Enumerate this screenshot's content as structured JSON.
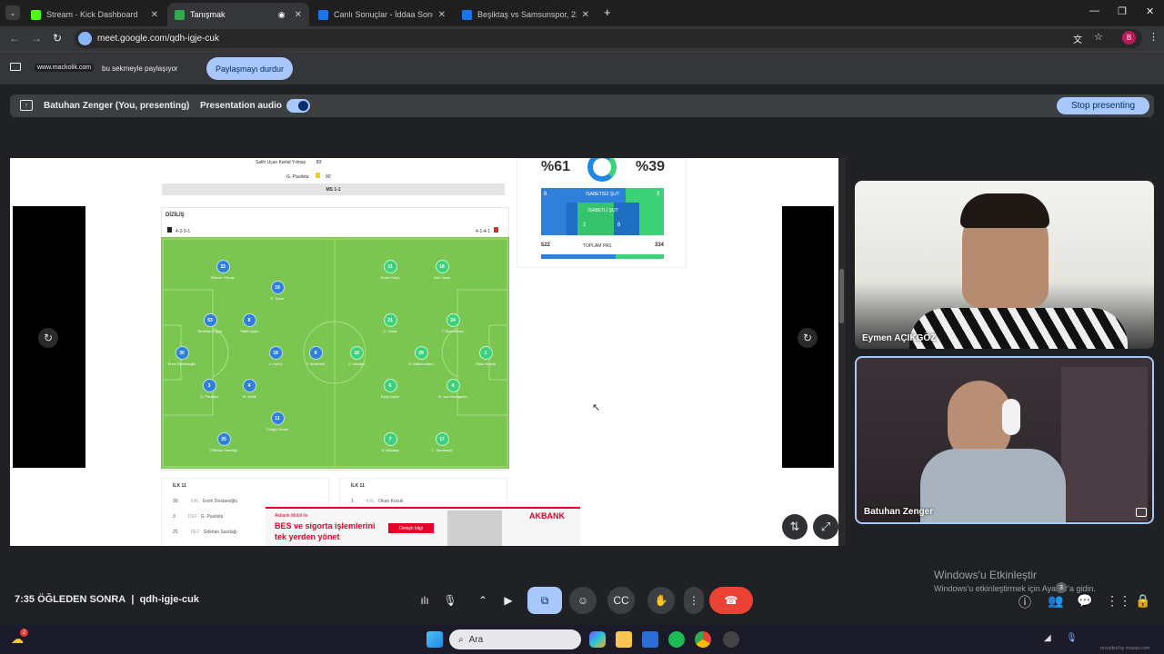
{
  "browser": {
    "tabs": [
      {
        "title": "Stream - Kick Dashboard",
        "active": false,
        "fav_color": "#53fc18"
      },
      {
        "title": "Tanışmak",
        "active": true,
        "fav_color": "#34a853"
      },
      {
        "title": "Canlı Sonuçlar - İddaa Sonuçları",
        "active": false,
        "fav_color": "#1a73e8"
      },
      {
        "title": "Beşiktaş vs Samsunspor, 23 Ş",
        "active": false,
        "fav_color": "#1a73e8"
      }
    ],
    "url": "meet.google.com/qdh-igje-cuk",
    "profile_initial": "B"
  },
  "share_bar": {
    "site": "www.mackolik.com",
    "text": "bu sekmeyle paylaşıyor",
    "stop_label": "Paylaşmayı durdur"
  },
  "presenting": {
    "name": "Batuhan Zenger (You, presenting)",
    "audio_label": "Presentation audio",
    "stop_label": "Stop presenting"
  },
  "shared": {
    "events": [
      {
        "text": "Salih Uçan  Kartal Yılmaz",
        "minute": "89'"
      },
      {
        "text": "G. Paulista",
        "minute": "90'"
      }
    ],
    "ms_label": "MS 1-1",
    "lineup_title": "DİZİLİŞ",
    "home_formation": "4-2-3-1",
    "away_formation": "4-1-4-1",
    "home_players": [
      {
        "num": "33",
        "name": "Rıdvan Yılmaz"
      },
      {
        "num": "19",
        "name": "E. Toure"
      },
      {
        "num": "53",
        "name": "Emirhan Topçu"
      },
      {
        "num": "8",
        "name": "Salih Uçan"
      },
      {
        "num": "30",
        "name": "Ersin Destanoğlu"
      },
      {
        "num": "18",
        "name": "V. Cerny"
      },
      {
        "num": "9",
        "name": "T. Abraham"
      },
      {
        "num": "3",
        "name": "G. Paulista"
      },
      {
        "num": "4",
        "name": "W. Ndidi"
      },
      {
        "num": "11",
        "name": "Cengiz Ünder"
      },
      {
        "num": "25",
        "name": "Gökhan Sazdağı"
      }
    ],
    "away_players": [
      {
        "num": "11",
        "name": "Emre Kılınç"
      },
      {
        "num": "18",
        "name": "Zeki Yavru"
      },
      {
        "num": "21",
        "name": "C. Holse"
      },
      {
        "num": "24",
        "name": "T. Bavcekovic"
      },
      {
        "num": "19",
        "name": "C. Ndiaye"
      },
      {
        "num": "29",
        "name": "A. Makoumbou"
      },
      {
        "num": "1",
        "name": "Okan Kocuk"
      },
      {
        "num": "6",
        "name": "Eyüp Aydın"
      },
      {
        "num": "4",
        "name": "R. van Drongelen"
      },
      {
        "num": "7",
        "name": "A. Mouaba"
      },
      {
        "num": "17",
        "name": "L. Tomasson"
      }
    ],
    "stats": {
      "home_possession": "%61",
      "away_possession": "%39",
      "off_target_label": "İSABETSİZ ŞUT",
      "off_target_home": "8",
      "off_target_away": "3",
      "on_target_label": "İSABETLİ ŞUT",
      "on_target_home": "2",
      "on_target_away": "6",
      "pass_home": "522",
      "pass_label": "TOPLAM PAS",
      "pass_away": "334"
    },
    "home_xi": {
      "title": "İLK 11",
      "rows": [
        {
          "num": "30",
          "pos": "KAL",
          "name": "Ersin Destanoğlu"
        },
        {
          "num": "3",
          "pos": "DEF",
          "name": "G. Paulista"
        },
        {
          "num": "25",
          "pos": "DEF",
          "name": "Gökhan Sazdağı"
        }
      ]
    },
    "away_xi": {
      "title": "İLK 11",
      "rows": [
        {
          "num": "1",
          "pos": "KAL",
          "name": "Okan Kocuk"
        }
      ]
    },
    "ad": {
      "small": "Akbank Mobil ile",
      "line1": "BES ve sigorta işlemlerini",
      "line2": "tek yerden yönet",
      "cta": "Detaylı bilgi",
      "brand": "AKBANK"
    }
  },
  "participants": [
    {
      "name": "Eymen AÇIKGÖZ"
    },
    {
      "name": "Batuhan Zenger"
    }
  ],
  "bottom": {
    "time": "7:35 ÖĞLEDEN SONRA",
    "separator": "|",
    "meeting_code": "qdh-igje-cuk",
    "win_activate_title": "Windows'u Etkinleştir",
    "win_activate_sub": "Windows'u etkinleştirmek için Ayarlar'a gidin.",
    "people_count": "3"
  },
  "taskbar": {
    "search_placeholder": "Ara",
    "notif_count": "2"
  },
  "watermark": "recorded by movavi.com"
}
